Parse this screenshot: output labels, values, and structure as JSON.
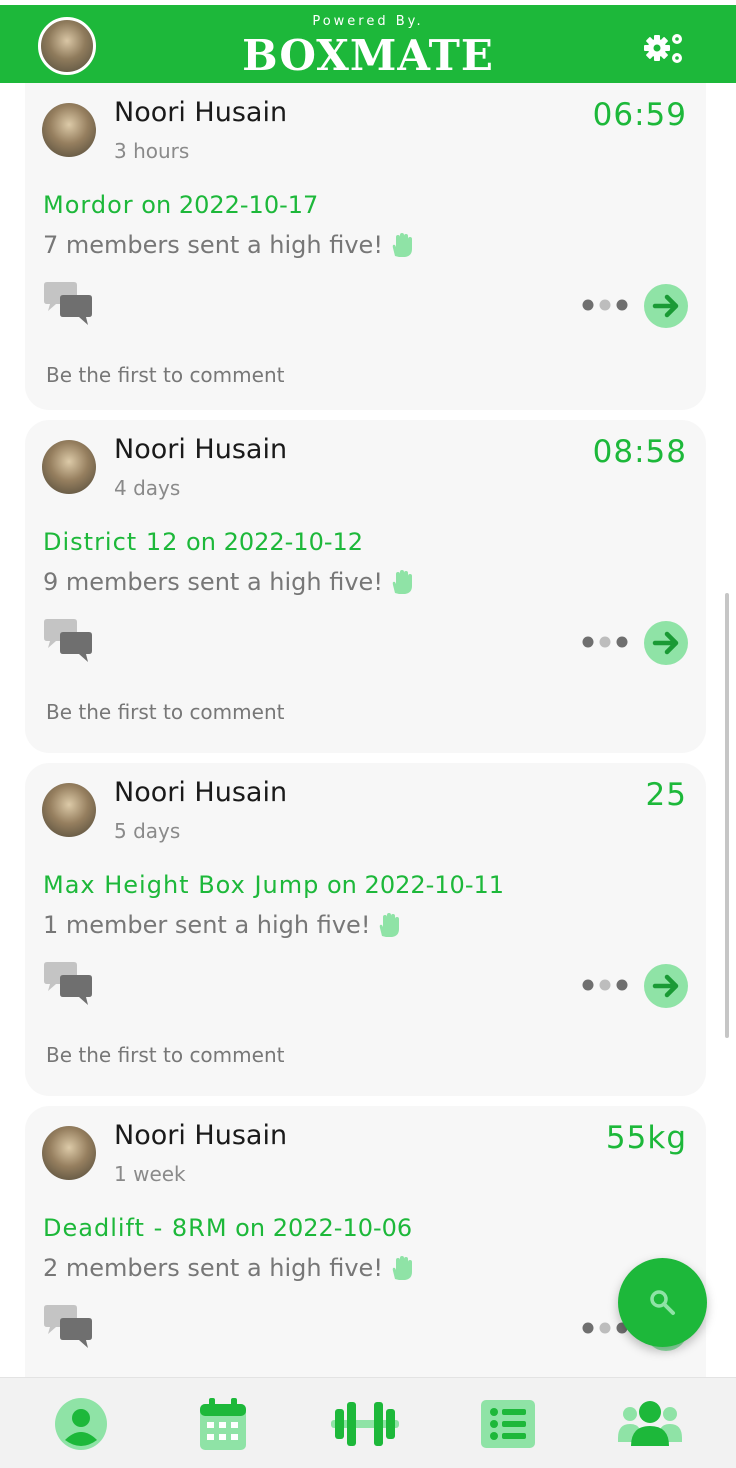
{
  "header": {
    "powered_by": "Powered By.",
    "brand": "BOXMATE",
    "avatar_icon": "user-avatar",
    "settings_icon": "gears-icon",
    "brand_color": "#1db83a"
  },
  "feed": {
    "cards": [
      {
        "name": "Noori Husain",
        "ago": "3 hours",
        "score": "06:59",
        "workout": "Mordor",
        "on": "on",
        "date": "2022-10-17",
        "high_five": "7 members sent a high five!",
        "comment": "Be the first to comment"
      },
      {
        "name": "Noori Husain",
        "ago": "4 days",
        "score": "08:58",
        "workout": "District 12",
        "on": "on",
        "date": "2022-10-12",
        "high_five": "9 members sent a high five!",
        "comment": "Be the first to comment"
      },
      {
        "name": "Noori Husain",
        "ago": "5 days",
        "score": "25",
        "workout": "Max Height Box Jump",
        "on": "on",
        "date": "2022-10-11",
        "high_five": "1 member sent a high five!",
        "comment": "Be the first to comment"
      },
      {
        "name": "Noori Husain",
        "ago": "1 week",
        "score": "55kg",
        "workout": "Deadlift - 8RM",
        "on": "on",
        "date": "2022-10-06",
        "high_five": "2 members sent a high five!",
        "comment": ""
      }
    ]
  },
  "fab": {
    "icon": "search-icon"
  },
  "bottom_nav": {
    "items": [
      {
        "icon": "profile-icon"
      },
      {
        "icon": "calendar-icon"
      },
      {
        "icon": "dumbbell-icon"
      },
      {
        "icon": "list-icon"
      },
      {
        "icon": "group-icon"
      }
    ]
  }
}
